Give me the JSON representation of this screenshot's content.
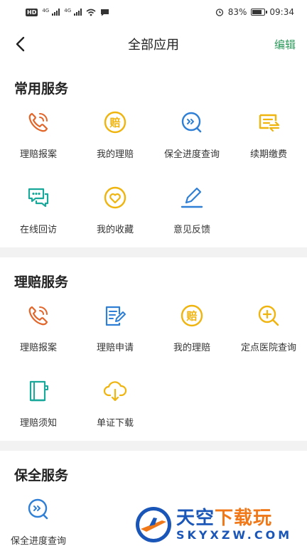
{
  "status_bar": {
    "battery": "83%",
    "time": "09:34",
    "network_1": "4G",
    "network_2": "4G",
    "battery_level": 0.83
  },
  "nav": {
    "title": "全部应用",
    "edit": "编辑"
  },
  "colors": {
    "accent_green": "#2e9a5c",
    "orange": "#e2662a",
    "yellow": "#f0b40f",
    "blue": "#2f7fd6",
    "teal": "#1aa89a"
  },
  "sections": [
    {
      "title": "常用服务",
      "items": [
        {
          "label": "理赔报案",
          "icon": "phone-call-icon"
        },
        {
          "label": "我的理赔",
          "icon": "claim-coin-icon"
        },
        {
          "label": "保全进度查询",
          "icon": "progress-search-icon"
        },
        {
          "label": "续期缴费",
          "icon": "renewal-payment-icon"
        },
        {
          "label": "在线回访",
          "icon": "chat-bubbles-icon"
        },
        {
          "label": "我的收藏",
          "icon": "heart-circle-icon"
        },
        {
          "label": "意见反馈",
          "icon": "pen-feedback-icon"
        }
      ]
    },
    {
      "title": "理赔服务",
      "items": [
        {
          "label": "理赔报案",
          "icon": "phone-call-icon"
        },
        {
          "label": "理赔申请",
          "icon": "document-edit-icon"
        },
        {
          "label": "我的理赔",
          "icon": "claim-coin-icon"
        },
        {
          "label": "定点医院查询",
          "icon": "hospital-search-icon"
        },
        {
          "label": "理赔须知",
          "icon": "notice-book-icon"
        },
        {
          "label": "单证下载",
          "icon": "cloud-download-icon"
        }
      ]
    },
    {
      "title": "保全服务",
      "items": [
        {
          "label": "保全进度查询",
          "icon": "progress-search-icon"
        }
      ]
    }
  ],
  "watermark": {
    "chars_blue": "天空",
    "chars_orange": "下载玩",
    "domain": "SKYXZW.COM"
  }
}
